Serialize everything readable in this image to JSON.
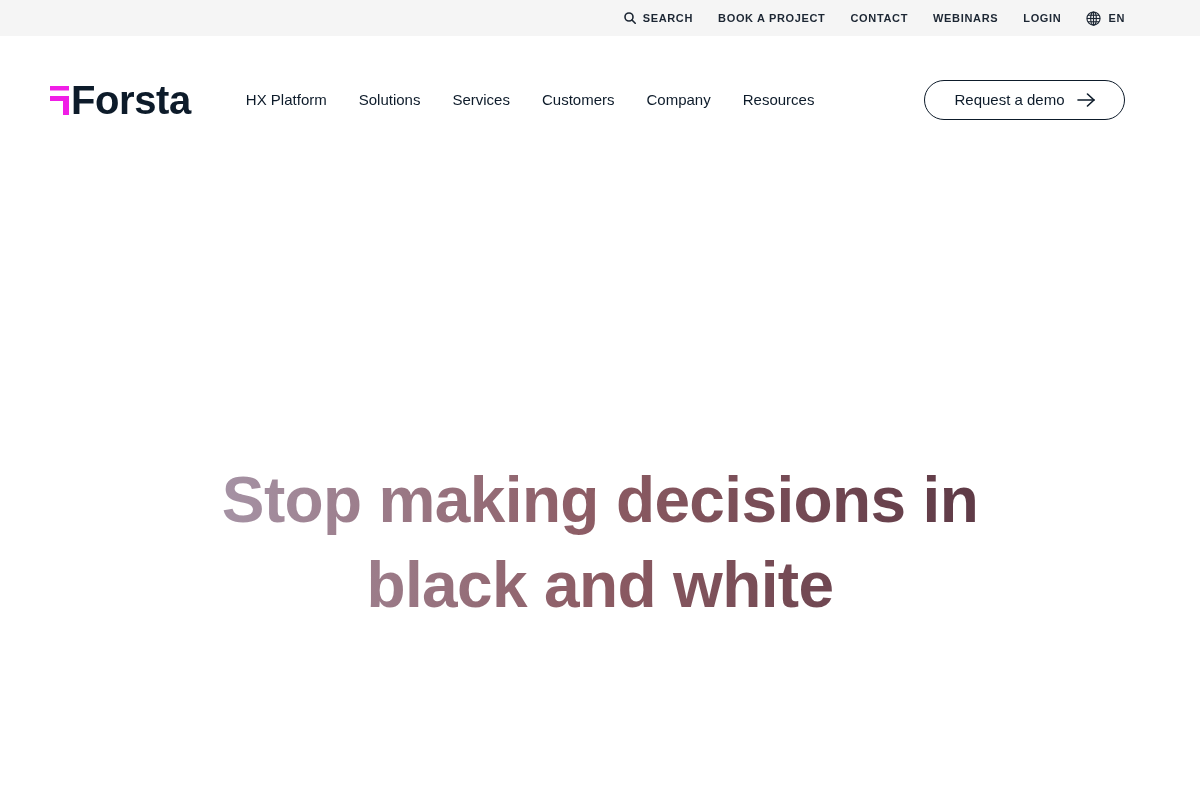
{
  "utility_nav": {
    "search": "SEARCH",
    "links": [
      "BOOK A PROJECT",
      "CONTACT",
      "WEBINARS",
      "LOGIN"
    ],
    "language": "EN"
  },
  "logo": {
    "text": "Forsta"
  },
  "main_nav": [
    "HX Platform",
    "Solutions",
    "Services",
    "Customers",
    "Company",
    "Resources"
  ],
  "cta_button": "Request a demo",
  "hero": {
    "headline": "Stop making decisions in black and white"
  }
}
